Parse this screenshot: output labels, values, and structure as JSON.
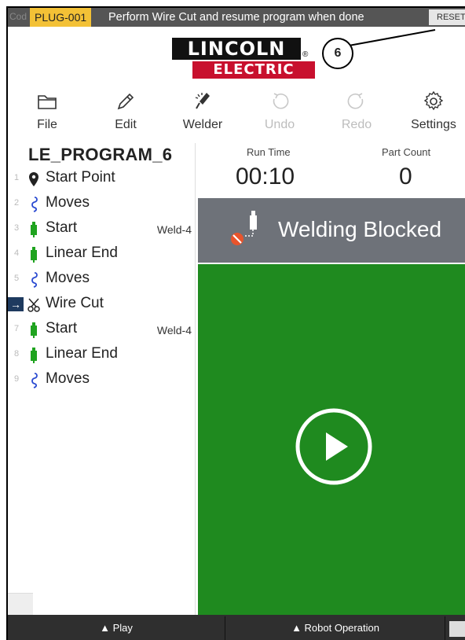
{
  "alert": {
    "code_prefix": "Cod",
    "code": "PLUG-001",
    "message": "Perform Wire Cut and resume program when done",
    "reset_label": "RESET"
  },
  "logo": {
    "line1": "LINCOLN",
    "line2": "ELECTRIC",
    "registered": "®"
  },
  "callout": {
    "number": "6"
  },
  "toolbar": {
    "items": [
      {
        "label": "File",
        "icon": "folder-icon",
        "enabled": true
      },
      {
        "label": "Edit",
        "icon": "pencil-icon",
        "enabled": true
      },
      {
        "label": "Welder",
        "icon": "torch-icon",
        "enabled": true
      },
      {
        "label": "Undo",
        "icon": "undo-icon",
        "enabled": false
      },
      {
        "label": "Redo",
        "icon": "redo-icon",
        "enabled": false
      },
      {
        "label": "Settings",
        "icon": "gear-icon",
        "enabled": true
      }
    ]
  },
  "program": {
    "title": "LE_PROGRAM_6",
    "steps": [
      {
        "num": "1",
        "label": "Start Point",
        "icon": "location-pin-icon",
        "tag": ""
      },
      {
        "num": "2",
        "label": "Moves",
        "icon": "path-icon",
        "tag": ""
      },
      {
        "num": "3",
        "label": "Start",
        "icon": "weld-torch-icon",
        "tag": "Weld-4"
      },
      {
        "num": "4",
        "label": "Linear End",
        "icon": "weld-torch-icon",
        "tag": ""
      },
      {
        "num": "5",
        "label": "Moves",
        "icon": "path-icon",
        "tag": ""
      },
      {
        "num": "→",
        "label": "Wire Cut",
        "icon": "scissors-icon",
        "tag": "",
        "current": true
      },
      {
        "num": "7",
        "label": "Start",
        "icon": "weld-torch-icon",
        "tag": "Weld-4"
      },
      {
        "num": "8",
        "label": "Linear End",
        "icon": "weld-torch-icon",
        "tag": ""
      },
      {
        "num": "9",
        "label": "Moves",
        "icon": "path-icon",
        "tag": ""
      }
    ]
  },
  "stats": {
    "run_time_label": "Run Time",
    "run_time_value": "00:10",
    "part_count_label": "Part Count",
    "part_count_value": "0"
  },
  "status": {
    "blocked_label": "Welding Blocked"
  },
  "bottom": {
    "play_label": "▲ Play",
    "robot_label": "▲ Robot Operation"
  },
  "colors": {
    "alert_bg": "#555555",
    "code_bg": "#f3c136",
    "brand_red": "#c8102e",
    "blocked_bg": "#6e7279",
    "play_area": "#1f8a1f",
    "weld_green": "#1fa31f",
    "path_blue": "#2b4bd1"
  }
}
